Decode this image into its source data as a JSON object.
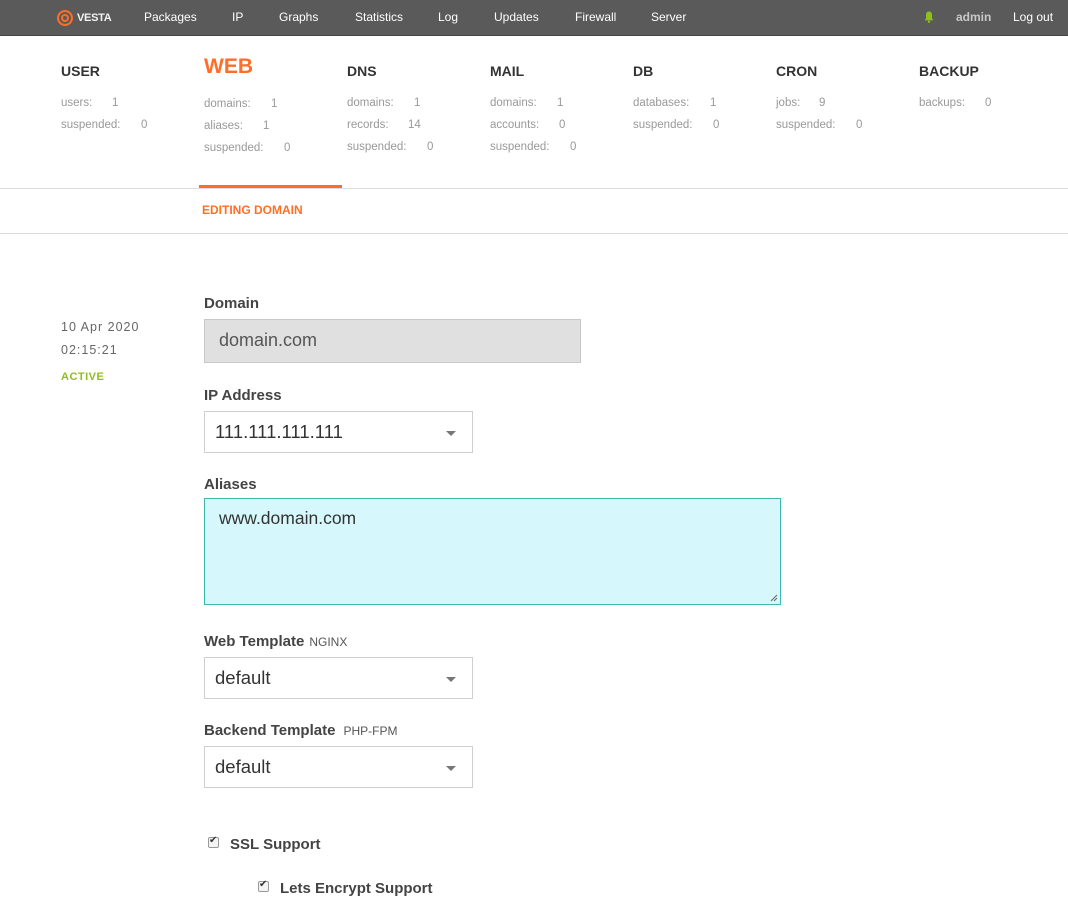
{
  "topbar": {
    "logo_text": "VESTA",
    "nav": [
      "Packages",
      "IP",
      "Graphs",
      "Statistics",
      "Log",
      "Updates",
      "Firewall",
      "Server"
    ],
    "user": "admin",
    "logout": "Log out",
    "bell_color": "#8fbf1c"
  },
  "stats": {
    "user": {
      "title": "USER",
      "rows": [
        {
          "k": "users:",
          "v": "1"
        },
        {
          "k": "suspended:",
          "v": "0"
        }
      ]
    },
    "web": {
      "title": "WEB",
      "rows": [
        {
          "k": "domains:",
          "v": "1"
        },
        {
          "k": "aliases:",
          "v": "1"
        },
        {
          "k": "suspended:",
          "v": "0"
        }
      ]
    },
    "dns": {
      "title": "DNS",
      "rows": [
        {
          "k": "domains:",
          "v": "1"
        },
        {
          "k": "records:",
          "v": "14"
        },
        {
          "k": "suspended:",
          "v": "0"
        }
      ]
    },
    "mail": {
      "title": "MAIL",
      "rows": [
        {
          "k": "domains:",
          "v": "1"
        },
        {
          "k": "accounts:",
          "v": "0"
        },
        {
          "k": "suspended:",
          "v": "0"
        }
      ]
    },
    "db": {
      "title": "DB",
      "rows": [
        {
          "k": "databases:",
          "v": "1"
        },
        {
          "k": "suspended:",
          "v": "0"
        }
      ]
    },
    "cron": {
      "title": "CRON",
      "rows": [
        {
          "k": "jobs:",
          "v": "9"
        },
        {
          "k": "suspended:",
          "v": "0"
        }
      ]
    },
    "backup": {
      "title": "BACKUP",
      "rows": [
        {
          "k": "backups:",
          "v": "0"
        }
      ]
    }
  },
  "page_title": "EDITING DOMAIN",
  "meta": {
    "date": "10 Apr 2020",
    "time": "02:15:21",
    "status": "ACTIVE"
  },
  "form": {
    "domain": {
      "label": "Domain",
      "value": "domain.com"
    },
    "ip": {
      "label": "IP Address",
      "value": "111.111.111.111"
    },
    "aliases": {
      "label": "Aliases",
      "value": "www.domain.com"
    },
    "web_template": {
      "label": "Web Template",
      "hint": "NGINX",
      "value": "default"
    },
    "backend_template": {
      "label": "Backend Template",
      "hint": "PHP-FPM",
      "value": "default"
    },
    "ssl": {
      "label": "SSL Support",
      "checked": true
    },
    "letsencrypt": {
      "label": "Lets Encrypt Support",
      "checked": true
    }
  },
  "colors": {
    "accent": "#ff6e28",
    "active_status": "#8fbf1c",
    "textarea_bg": "#d6f7fb",
    "textarea_border": "#3fb9b0"
  }
}
